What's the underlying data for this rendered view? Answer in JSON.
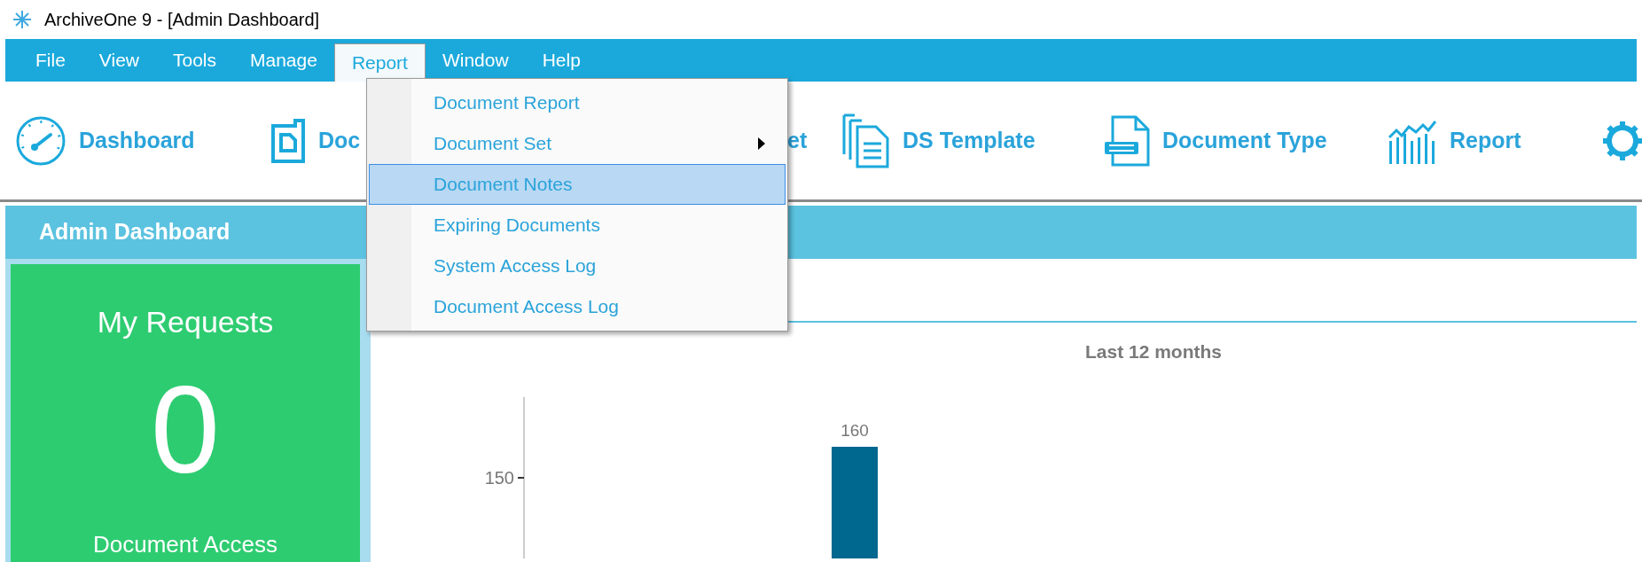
{
  "window": {
    "title": "ArchiveOne 9 - [Admin Dashboard]"
  },
  "menu_bar": [
    {
      "label": "File",
      "selected": false
    },
    {
      "label": "View",
      "selected": false
    },
    {
      "label": "Tools",
      "selected": false
    },
    {
      "label": "Manage",
      "selected": false
    },
    {
      "label": "Report",
      "selected": true
    },
    {
      "label": "Window",
      "selected": false
    },
    {
      "label": "Help",
      "selected": false
    }
  ],
  "report_menu": [
    {
      "label": "Document Report",
      "selected": false,
      "submenu": false
    },
    {
      "label": "Document Set",
      "selected": false,
      "submenu": true
    },
    {
      "label": "Document Notes",
      "selected": true,
      "submenu": false
    },
    {
      "label": "Expiring Documents",
      "selected": false,
      "submenu": false
    },
    {
      "label": "System Access Log",
      "selected": false,
      "submenu": false
    },
    {
      "label": "Document Access Log",
      "selected": false,
      "submenu": false
    }
  ],
  "toolbar": [
    {
      "label": "Dashboard"
    },
    {
      "label": "Doc"
    },
    {
      "label": "et"
    },
    {
      "label": "DS Template"
    },
    {
      "label": "Document Type"
    },
    {
      "label": "Report"
    }
  ],
  "panel": {
    "title": "Admin Dashboard"
  },
  "requests_card": {
    "title": "My Requests",
    "count": "0",
    "caption": "Document Access"
  },
  "chart": {
    "title": "Last 12 months",
    "tick_label": "150",
    "bar_label": "160"
  }
}
